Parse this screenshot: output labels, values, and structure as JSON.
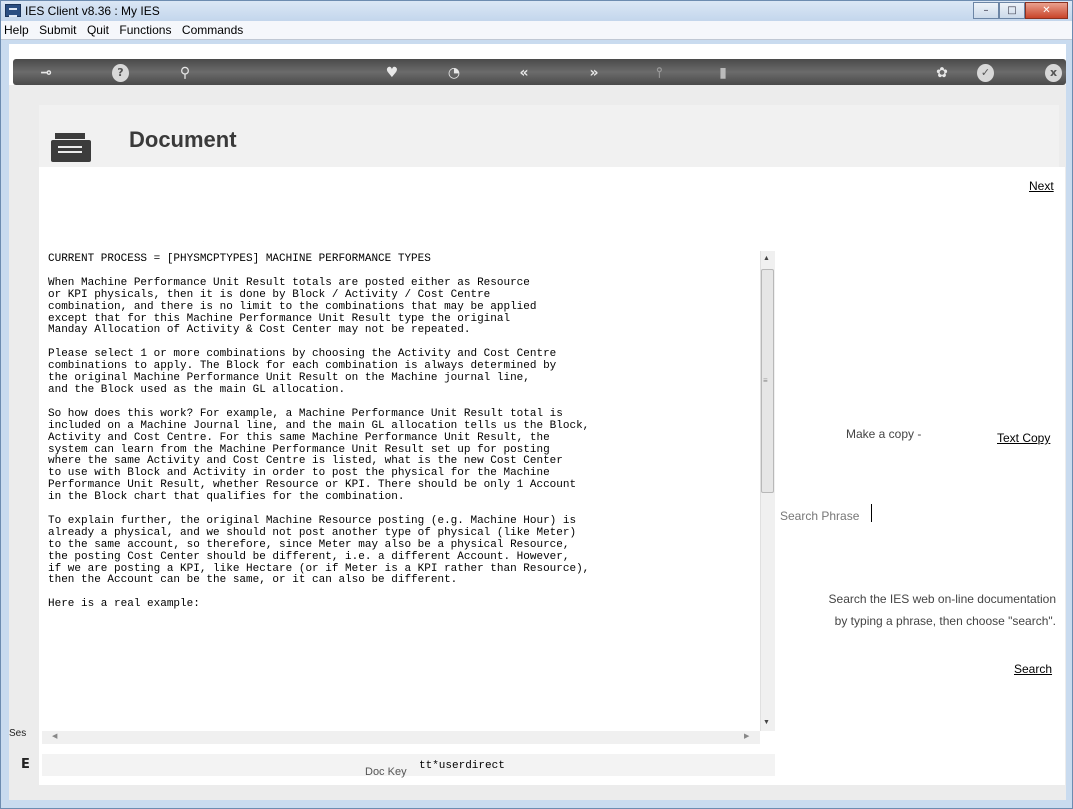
{
  "window": {
    "title": "IES Client v8.36 : My IES",
    "minimize_glyph": "–",
    "maximize_glyph": "□",
    "close_glyph": "✕"
  },
  "menu": [
    "Help",
    "Submit",
    "Quit",
    "Functions",
    "Commands"
  ],
  "toolbar": {
    "icons": [
      "key-icon",
      "help-icon",
      "search-icon",
      "heart-icon",
      "clock-icon",
      "back-icon",
      "forward-icon",
      "pin-icon",
      "stop-icon",
      "settings-icon",
      "ok-icon",
      "exit-icon"
    ],
    "glyphs": {
      "key": "⊸",
      "help": "?",
      "search": "⚲",
      "heart": "♥",
      "clock": "◔",
      "back": "«",
      "forward": "»",
      "pin": "⫯",
      "stop": "▮",
      "settings": "✿",
      "ok": "✓",
      "exit": "x"
    }
  },
  "header": {
    "title": "Document"
  },
  "links": {
    "next": "Next",
    "text_copy": "Text Copy",
    "search": "Search"
  },
  "document": {
    "text": "CURRENT PROCESS = [PHYSMCPTYPES] MACHINE PERFORMANCE TYPES\n\nWhen Machine Performance Unit Result totals are posted either as Resource\nor KPI physicals, then it is done by Block / Activity / Cost Centre\ncombination, and there is no limit to the combinations that may be applied\nexcept that for this Machine Performance Unit Result type the original\nManday Allocation of Activity & Cost Center may not be repeated.\n\nPlease select 1 or more combinations by choosing the Activity and Cost Centre\ncombinations to apply. The Block for each combination is always determined by\nthe original Machine Performance Unit Result on the Machine journal line,\nand the Block used as the main GL allocation.\n\nSo how does this work? For example, a Machine Performance Unit Result total is\nincluded on a Machine Journal line, and the main GL allocation tells us the Block,\nActivity and Cost Centre. For this same Machine Performance Unit Result, the\nsystem can learn from the Machine Performance Unit Result set up for posting\nwhere the same Activity and Cost Centre is listed, what is the new Cost Center\nto use with Block and Activity in order to post the physical for the Machine\nPerformance Unit Result, whether Resource or KPI. There should be only 1 Account\nin the Block chart that qualifies for the combination.\n\nTo explain further, the original Machine Resource posting (e.g. Machine Hour) is\nalready a physical, and we should not post another type of physical (like Meter)\nto the same account, so therefore, since Meter may also be a physical Resource,\nthe posting Cost Center should be different, i.e. a different Account. However,\nif we are posting a KPI, like Hectare (or if Meter is a KPI rather than Resource),\nthen the Account can be the same, or it can also be different.\n\nHere is a real example:"
  },
  "side": {
    "copy_label": "Make a copy -",
    "search_label": "Search Phrase",
    "search_value": "",
    "help_line1": "Search the IES web on-line documentation",
    "help_line2": "by typing a phrase, then choose \"search\"."
  },
  "footer": {
    "doc_key_label": "Doc Key",
    "doc_key_value": "tt*userdirect",
    "session_stub": "Ses",
    "stub_char": "E"
  }
}
